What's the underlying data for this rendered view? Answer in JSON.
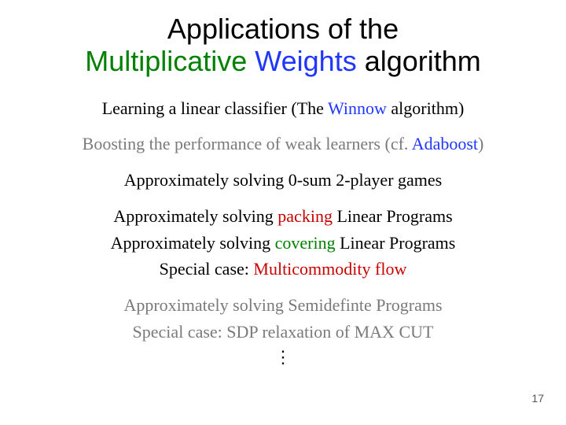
{
  "title": {
    "line1_pre": "Applications of the",
    "line2_word1": "Multiplicative",
    "line2_word2": "Weights",
    "line2_word3": "algorithm"
  },
  "b1": {
    "pre": "Learning a linear classifier (The ",
    "em": "Winnow",
    "post": " algorithm)"
  },
  "b2": {
    "pre": "Boosting the performance of weak learners (cf. ",
    "em": "Adaboost",
    "post": ")"
  },
  "b3": {
    "full": "Approximately solving 0-sum 2-player games"
  },
  "b4a": {
    "pre": "Approximately solving ",
    "em": "packing",
    "post": " Linear Programs"
  },
  "b4b": {
    "pre": "Approximately solving ",
    "em": "covering",
    "post": " Linear Programs"
  },
  "b4c": {
    "pre": "Special case: ",
    "em": "Multicommodity flow"
  },
  "b5a": {
    "full": "Approximately solving Semidefinte Programs"
  },
  "b5b": {
    "pre": "Special case: ",
    "em": "SDP relaxation of MAX CUT"
  },
  "vdots": "⋮",
  "page_number": "17"
}
